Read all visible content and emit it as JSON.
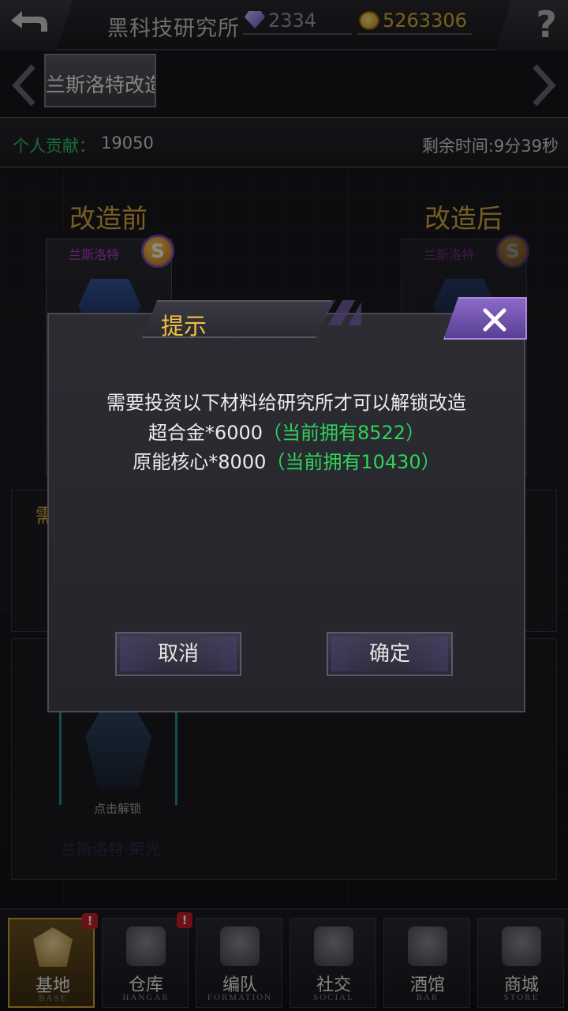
{
  "header": {
    "title": "黑科技研究所",
    "gems": "2334",
    "gold": "5263306",
    "back_icon": "back-arrow-icon",
    "help_icon": "question-mark-icon",
    "help_symbol": "?"
  },
  "selector": {
    "unit_name": "兰斯洛特改造"
  },
  "info": {
    "contribution_label": "个人贡献：",
    "contribution_value": "19050",
    "time_remaining": "剩余时间:9分39秒"
  },
  "stage": {
    "before_label": "改造前",
    "after_label": "改造后",
    "before_unit_name": "兰斯洛特",
    "after_unit_name": "兰斯洛特",
    "rank": "S",
    "requirement_label": "需"
  },
  "lower": {
    "unlock_hint": "点击解锁",
    "unit_name": "兰斯洛特·荣光"
  },
  "dialog": {
    "title": "提示",
    "line1": "需要投资以下材料给研究所才可以解锁改造",
    "line2_main": "超合金*6000",
    "line2_owned": "（当前拥有8522）",
    "line3_main": "原能核心*8000",
    "line3_owned": "（当前拥有10430）",
    "cancel_label": "取消",
    "confirm_label": "确定",
    "owned_color": "#2fd35a"
  },
  "nav": {
    "items": [
      {
        "label": "基地",
        "sub": "BASE",
        "icon": "base-icon",
        "active": true,
        "badge": "!"
      },
      {
        "label": "仓库",
        "sub": "HANGAR",
        "icon": "hangar-icon",
        "active": false,
        "badge": "!"
      },
      {
        "label": "编队",
        "sub": "FORMATION",
        "icon": "formation-icon",
        "active": false
      },
      {
        "label": "社交",
        "sub": "SOCIAL",
        "icon": "social-icon",
        "active": false
      },
      {
        "label": "酒馆",
        "sub": "BAR",
        "icon": "bar-icon",
        "active": false
      },
      {
        "label": "商城",
        "sub": "STORE",
        "icon": "store-icon",
        "active": false
      }
    ]
  },
  "colors": {
    "accent_gold": "#d9a93c",
    "title_yellow": "#f0c040",
    "close_purple": "#8a6ac8",
    "contrib_green": "#33c46a",
    "badge_red": "#c8202a"
  }
}
